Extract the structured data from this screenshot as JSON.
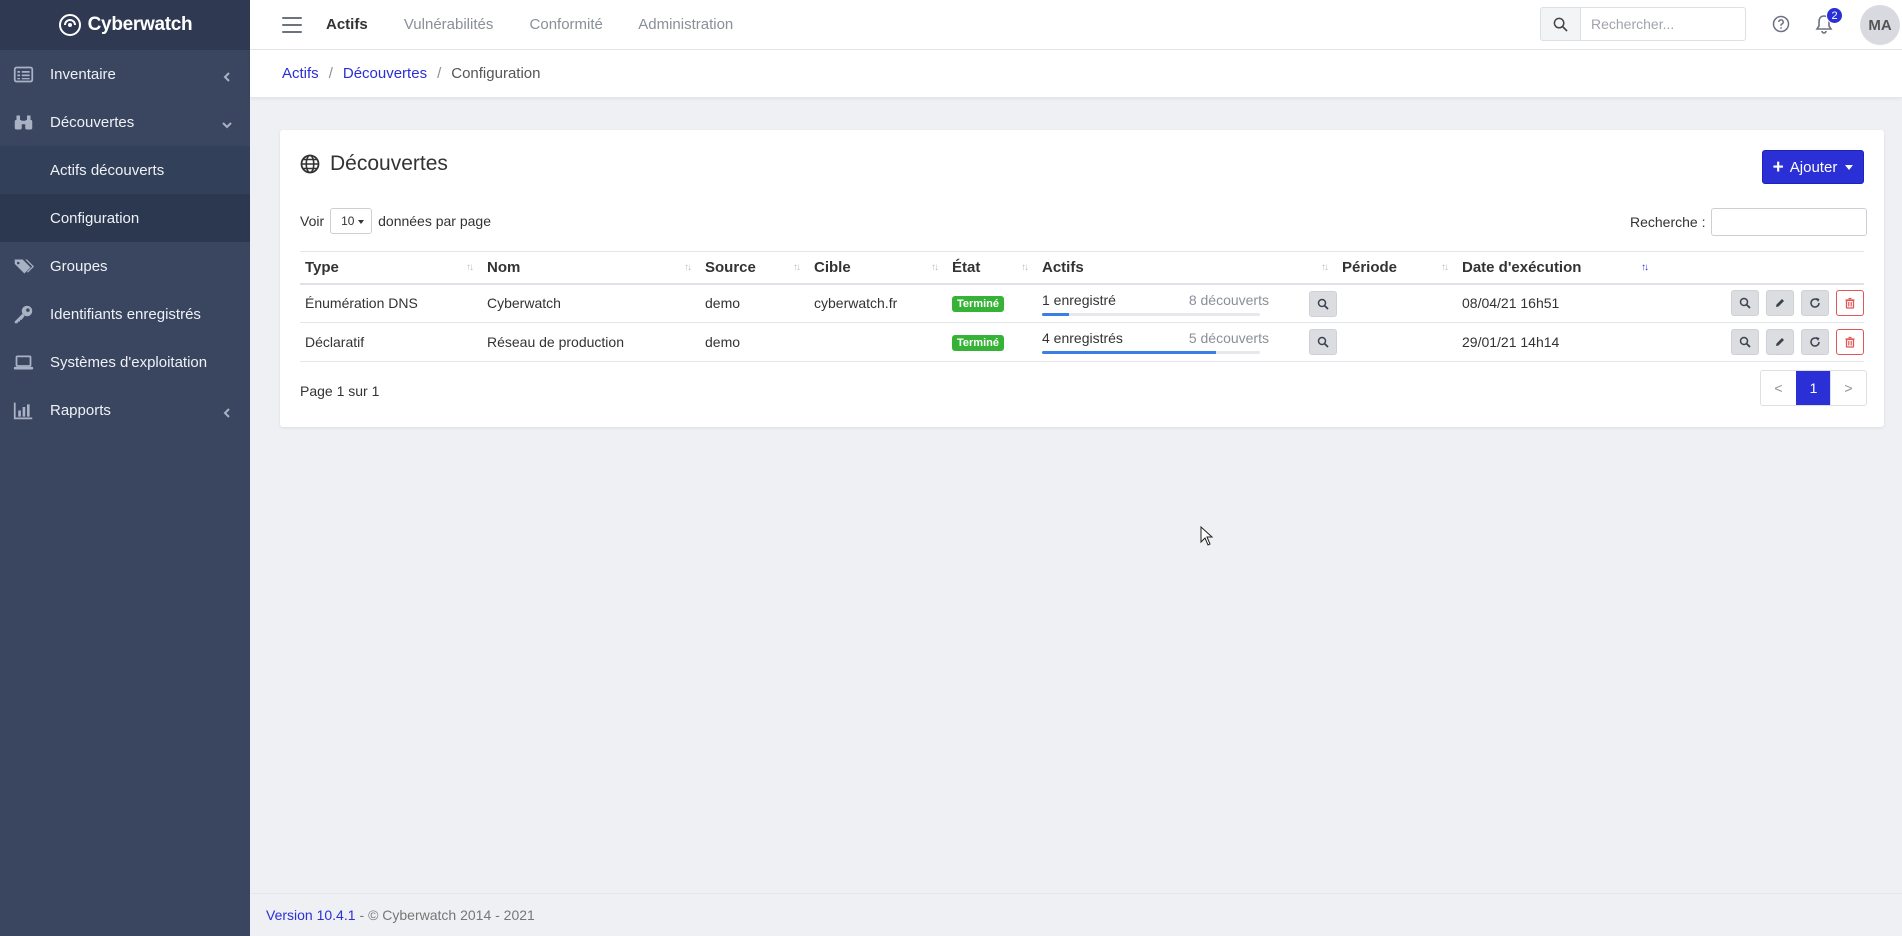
{
  "brand": {
    "name": "Cyberwatch"
  },
  "sidebar": {
    "items": [
      {
        "label": "Inventaire",
        "icon": "list-icon",
        "chevron": "left"
      },
      {
        "label": "Découvertes",
        "icon": "binoculars-icon",
        "chevron": "down",
        "children": [
          {
            "label": "Actifs découverts"
          },
          {
            "label": "Configuration",
            "active": true
          }
        ]
      },
      {
        "label": "Groupes",
        "icon": "tags-icon"
      },
      {
        "label": "Identifiants enregistrés",
        "icon": "key-icon"
      },
      {
        "label": "Systèmes d'exploitation",
        "icon": "laptop-icon"
      },
      {
        "label": "Rapports",
        "icon": "bar-chart-icon",
        "chevron": "left"
      }
    ]
  },
  "topbar": {
    "nav": [
      "Actifs",
      "Vulnérabilités",
      "Conformité",
      "Administration"
    ],
    "active_nav": "Actifs",
    "search_placeholder": "Rechercher...",
    "notifications": "2",
    "avatar_initials": "MA"
  },
  "breadcrumb": {
    "items": [
      "Actifs",
      "Découvertes"
    ],
    "current": "Configuration"
  },
  "card": {
    "title": "Découvertes",
    "add_label": "Ajouter",
    "voir_label": "Voir",
    "page_size": "10",
    "per_page_label": "données par page",
    "search_label": "Recherche :"
  },
  "table": {
    "headers": [
      "Type",
      "Nom",
      "Source",
      "Cible",
      "État",
      "Actifs",
      "Période",
      "Date d'exécution"
    ],
    "rows": [
      {
        "type": "Énumération DNS",
        "nom": "Cyberwatch",
        "source": "demo",
        "cible": "cyberwatch.fr",
        "etat": "Terminé",
        "actifs_enregistres": "1 enregistré",
        "actifs_decouverts": "8 découverts",
        "progress": 0.125,
        "periode": "",
        "date": "08/04/21 16h51"
      },
      {
        "type": "Déclaratif",
        "nom": "Réseau de production",
        "source": "demo",
        "cible": "",
        "etat": "Terminé",
        "actifs_enregistres": "4 enregistrés",
        "actifs_decouverts": "5 découverts",
        "progress": 0.8,
        "periode": "",
        "date": "29/01/21 14h14"
      }
    ]
  },
  "pagination": {
    "info": "Page 1 sur 1",
    "prev": "<",
    "current": "1",
    "next": ">"
  },
  "footer": {
    "version": "Version 10.4.1",
    "copyright": "- © Cyberwatch 2014 - 2021"
  },
  "colors": {
    "sidebar": "#3a4660",
    "accent": "#2a2fd6",
    "success": "#36b336",
    "danger": "#e05555"
  }
}
